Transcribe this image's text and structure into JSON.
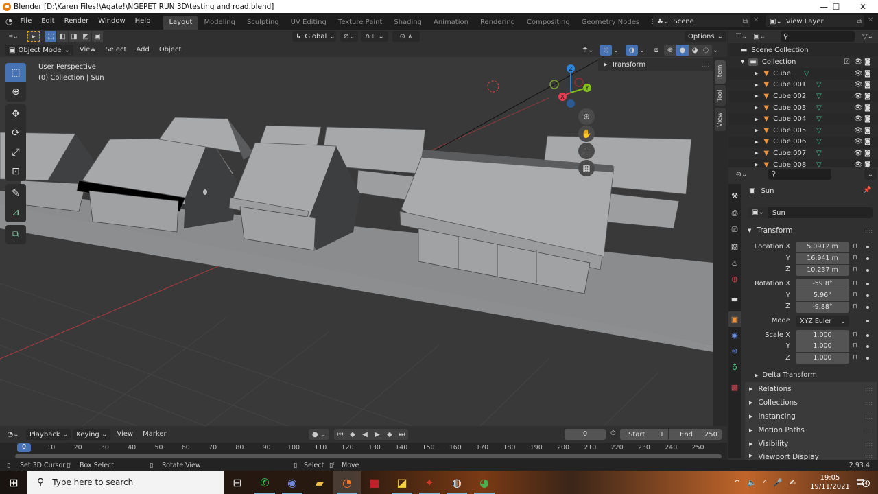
{
  "window": {
    "title": "Blender [D:\\Karen Files!\\Agate!\\NGEPET RUN 3D\\testing and road.blend]",
    "controls": {
      "minimize": "—",
      "maximize": "☐",
      "close": "✕"
    }
  },
  "menu": [
    "File",
    "Edit",
    "Render",
    "Window",
    "Help"
  ],
  "workspaces": [
    {
      "label": "Layout",
      "active": true
    },
    {
      "label": "Modeling"
    },
    {
      "label": "Sculpting"
    },
    {
      "label": "UV Editing"
    },
    {
      "label": "Texture Paint"
    },
    {
      "label": "Shading"
    },
    {
      "label": "Animation"
    },
    {
      "label": "Rendering"
    },
    {
      "label": "Compositing"
    },
    {
      "label": "Geometry Nodes"
    },
    {
      "label": "Scripting"
    }
  ],
  "add_workspace": "+",
  "scene": {
    "label": "Scene",
    "view_layer": "View Layer"
  },
  "tool_header": {
    "orientation": "Global",
    "options": "Options"
  },
  "viewport_header": {
    "mode": "Object Mode",
    "menus": [
      "View",
      "Select",
      "Add",
      "Object"
    ]
  },
  "viewport": {
    "perspective": "User Perspective",
    "context": "(0) Collection | Sun",
    "npanel_section": "Transform",
    "npanel_tabs": [
      "Item",
      "Tool",
      "View"
    ],
    "gizmo_axes": {
      "x": "X",
      "y": "Y",
      "z": "Z"
    },
    "colors": {
      "x": "#e93c53",
      "y": "#84c11c",
      "z": "#2e86dc",
      "bg": "#393939",
      "grid": "#444444",
      "red_axis": "#a03a40",
      "mesh": "#9a9c9e"
    }
  },
  "outliner": {
    "search_placeholder": "",
    "scene_collection": "Scene Collection",
    "collection": "Collection",
    "objects": [
      "Cube",
      "Cube.001",
      "Cube.002",
      "Cube.003",
      "Cube.004",
      "Cube.005",
      "Cube.006",
      "Cube.007",
      "Cube.008"
    ]
  },
  "properties": {
    "object_name": "Sun",
    "datablock_name": "Sun",
    "transform_title": "Transform",
    "location_label": "Location X",
    "rotation_label": "Rotation X",
    "scale_label": "Scale X",
    "axis_y": "Y",
    "axis_z": "Z",
    "location": [
      "5.0912 m",
      "16.941 m",
      "10.237 m"
    ],
    "rotation": [
      "-59.8°",
      "5.96°",
      "-9.88°"
    ],
    "mode_label": "Mode",
    "mode_value": "XYZ Euler",
    "scale": [
      "1.000",
      "1.000",
      "1.000"
    ],
    "delta_transform": "Delta Transform",
    "sections": [
      "Relations",
      "Collections",
      "Instancing",
      "Motion Paths",
      "Visibility",
      "Viewport Display"
    ]
  },
  "timeline": {
    "menus": [
      "Playback",
      "Keying",
      "View",
      "Marker"
    ],
    "current_frame": "0",
    "start_label": "Start",
    "start": "1",
    "end_label": "End",
    "end": "250",
    "ruler": [
      "0",
      "10",
      "20",
      "30",
      "40",
      "50",
      "60",
      "70",
      "80",
      "90",
      "100",
      "110",
      "120",
      "130",
      "140",
      "150",
      "160",
      "170",
      "180",
      "190",
      "200",
      "210",
      "220",
      "230",
      "240",
      "250"
    ]
  },
  "statusbar": {
    "hints": [
      "Set 3D Cursor",
      "Box Select",
      "Rotate View",
      "Select",
      "Move"
    ],
    "version": "2.93.4"
  },
  "taskbar": {
    "search_placeholder": "Type here to search",
    "time": "19:05",
    "date": "19/11/2021",
    "notifications": "4",
    "apps": [
      "task-view",
      "whatsapp",
      "discord",
      "file-explorer",
      "blender",
      "app-red",
      "sticky-notes",
      "app-game",
      "steam",
      "chrome"
    ]
  }
}
